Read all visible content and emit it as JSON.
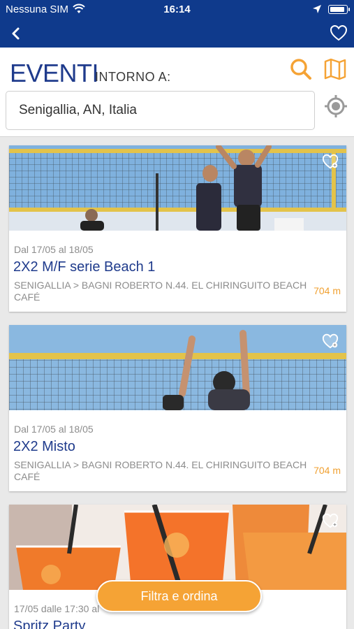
{
  "status_bar": {
    "carrier": "Nessuna SIM",
    "time": "16:14"
  },
  "header": {
    "title": "EVENTI",
    "subtitle": "INTORNO A:",
    "location_value": "Senigallia, AN, Italia"
  },
  "events": [
    {
      "dates": "Dal 17/05 al 18/05",
      "name": "2X2 M/F serie Beach 1",
      "place": "SENIGALLIA > BAGNI ROBERTO N.44. EL CHIRINGUITO BEACH CAFÉ",
      "distance": "704 m"
    },
    {
      "dates": "Dal 17/05 al 18/05",
      "name": "2X2 Misto",
      "place": "SENIGALLIA > BAGNI ROBERTO N.44. EL CHIRINGUITO BEACH CAFÉ",
      "distance": "704 m"
    },
    {
      "dates": "17/05 dalle 17:30 al",
      "name": "Spritz Party",
      "place": "",
      "distance": ""
    }
  ],
  "filter_button": "Filtra e ordina",
  "colors": {
    "brand_blue": "#0f3a8c",
    "accent_orange": "#f5a335",
    "title_blue": "#1f3b8c"
  }
}
